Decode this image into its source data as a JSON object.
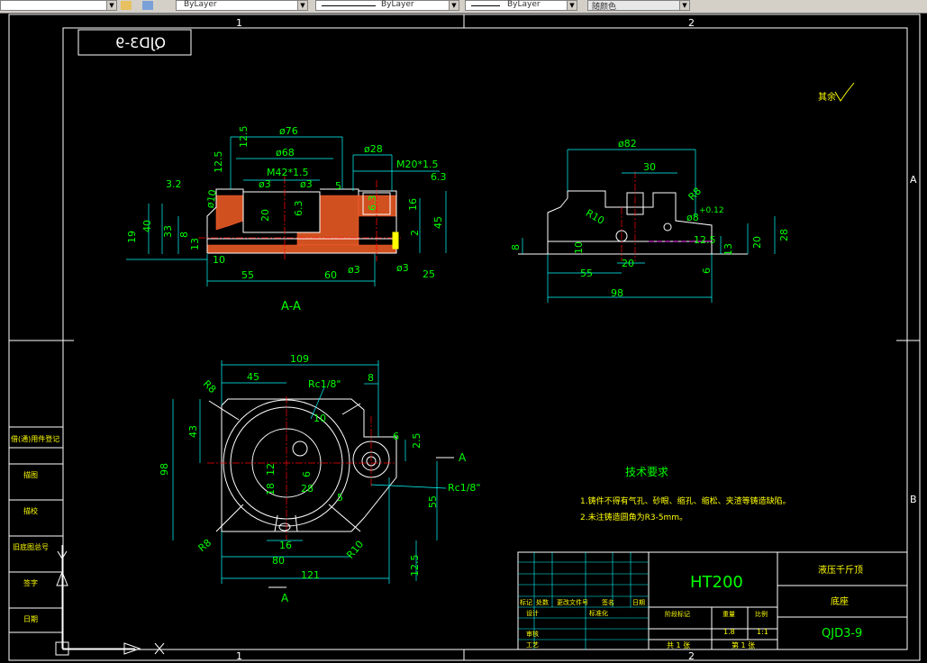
{
  "toolbar": {
    "layer_color": "ByLayer",
    "linetype": "ByLayer",
    "lineweight": "ByLayer",
    "plot_style": "随颜色"
  },
  "frame": {
    "zone_top_1": "1",
    "zone_top_2": "2",
    "zone_bottom_1": "1",
    "zone_bottom_2": "2",
    "zone_right_a": "A",
    "zone_right_b": "B"
  },
  "drawing": {
    "code_mirrored": "QJD3-9",
    "surface_rest": "其余",
    "section_label": "A-A",
    "view_arrow_a1": "A",
    "view_arrow_a2": "A",
    "section_dims": {
      "d76": "ø76",
      "d68": "ø68",
      "d28": "ø28",
      "m42": "M42*1.5",
      "m20": "M20*1.5",
      "d3a": "ø3",
      "d3b": "ø3",
      "d3c": "ø3",
      "d3d": "ø3",
      "d10": "ø10",
      "r12_5a": "12.5",
      "r12_5b": "12.5",
      "r3_2": "3.2",
      "r6_3a": "6.3",
      "r6_3b": "6.3",
      "r6_3c": "6.3",
      "r25": "25",
      "v20": "20",
      "v5": "5",
      "v16": "16",
      "v2": "2",
      "v45": "45",
      "v19": "19",
      "v40": "40",
      "v33": "33",
      "v8": "8",
      "v13": "13",
      "v10": "10",
      "h55": "55",
      "h60": "60"
    },
    "side_dims": {
      "d82": "ø82",
      "h30": "30",
      "r10": "R10",
      "r8": "R8",
      "d8": "ø8",
      "tol": "+0.12",
      "r12_5": "12.5",
      "v13": "13",
      "v20": "20",
      "v28": "28",
      "v8": "8",
      "v10": "10",
      "h20": "20",
      "h55": "55",
      "h98": "98",
      "v6": "6"
    },
    "plan_dims": {
      "h109": "109",
      "h45": "45",
      "h8": "8",
      "rc1": "Rc1/8\"",
      "rc2": "Rc1/8\"",
      "r8a": "R8",
      "r8b": "R8",
      "r10": "R10",
      "v43": "43",
      "v98": "98",
      "v12": "12",
      "v18": "18",
      "v6a": "6",
      "v6b": "6",
      "v2_5": "2.5",
      "v55": "55",
      "h28": "28",
      "h5": "5",
      "h16": "16",
      "h80": "80",
      "h121": "121",
      "v12_5": "12.5",
      "v10": "10"
    },
    "tech_title": "技术要求",
    "tech_line1": "1.铸件不得有气孔、砂眼、缩孔、缩松、夹渣等铸造缺陷。",
    "tech_line2": "2.未注铸造圆角为R3-5mm。"
  },
  "title_block": {
    "material": "HT200",
    "product": "液压千斤顶",
    "part_name": "底座",
    "code": "QJD3-9",
    "scale_val_a": "1.8",
    "scale_val_b": "1:1",
    "sheets_a": "共 1 张",
    "sheets_b": "第 1 张",
    "lbl_mark": "标记",
    "lbl_count": "处数",
    "lbl_zone": "更改文件号",
    "lbl_sign": "签名",
    "lbl_date": "日期",
    "lbl_design": "设计",
    "lbl_std": "标准化",
    "lbl_stage": "阶段标记",
    "lbl_weight": "重量",
    "lbl_scale": "比例",
    "lbl_review": "审核",
    "lbl_process": "工艺"
  },
  "left_strip": {
    "row1": "借(通)用件登记",
    "row2": "描图",
    "row3": "描校",
    "row4": "旧底图总号",
    "row5": "签字",
    "row6": "日期"
  }
}
